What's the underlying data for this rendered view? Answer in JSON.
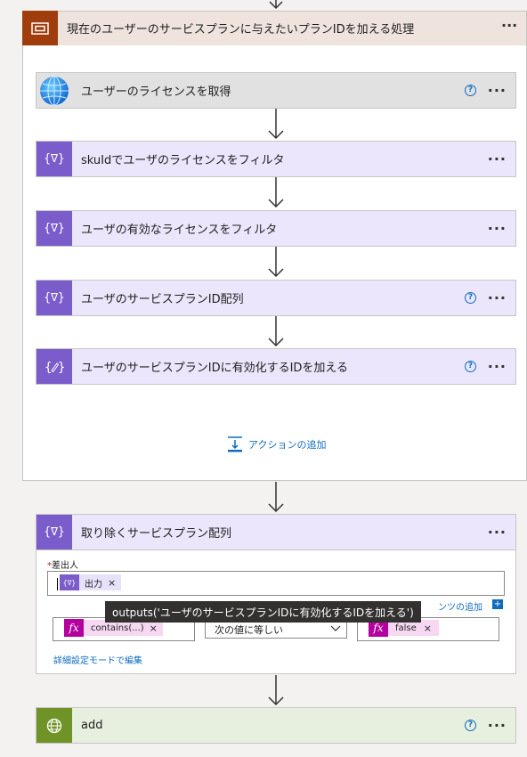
{
  "scope": {
    "title": "現在のユーザーのサービスプランに与えたいプランIDを加える処理",
    "add_action": "アクションの追加"
  },
  "cards": [
    {
      "title": "ユーザーのライセンスを取得"
    },
    {
      "title": "skuIdでユーザのライセンスをフィルタ"
    },
    {
      "title": "ユーザの有効なライセンスをフィルタ"
    },
    {
      "title": "ユーザのサービスプランID配列"
    },
    {
      "title": "ユーザのサービスプランIDに有効化するIDを加える"
    }
  ],
  "filter_card": {
    "title": "取り除くサービスプラン配列",
    "from_label": "差出人",
    "from_required": "*",
    "token_output": "出力",
    "dynamic_content_tail": "ンツの追加",
    "condition_left": "contains(...)",
    "condition_operator": "次の値に等しい",
    "condition_right": "false",
    "advanced_mode": "詳細設定モードで編集",
    "tooltip": "outputs('ユーザのサービスプランIDに有効化するIDを加える')"
  },
  "last_card": {
    "title": "add"
  },
  "icons": {
    "more": "···",
    "help": "?",
    "close": "×",
    "variable": "{∇}",
    "fx": "fx"
  },
  "colors": {
    "scope_header": "#efe4dd",
    "scope_icon": "#a03d0c",
    "data_op": "#7a5ccb",
    "data_op_bg": "#ebe6fb",
    "http": "#6f9326",
    "expression": "#b4009e",
    "link": "#0f6cbd"
  }
}
